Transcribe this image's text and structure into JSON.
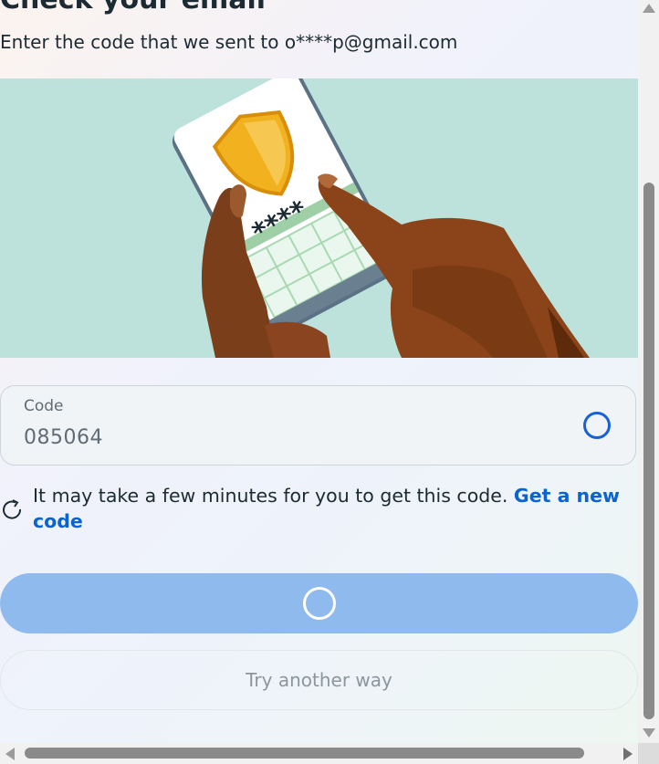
{
  "page": {
    "title": "Check your email",
    "subtitle": "Enter the code that we sent to o****p@gmail.com"
  },
  "illustration": {
    "masked_code": "****",
    "icon": "phone-shield-illustration"
  },
  "code_field": {
    "label": "Code",
    "value": "085064",
    "status_icon": "loading-spinner-icon"
  },
  "hint": {
    "text": "It may take a few minutes for you to get this code. ",
    "link": "Get a new code",
    "icon": "refresh-icon"
  },
  "buttons": {
    "continue_icon": "loading-spinner-icon",
    "alt_label": "Try another way"
  },
  "colors": {
    "accent": "#0b63d1",
    "primary_button_disabled": "#8fbaee",
    "illustration_bg": "#bde2db",
    "text": "#1c2b33"
  }
}
